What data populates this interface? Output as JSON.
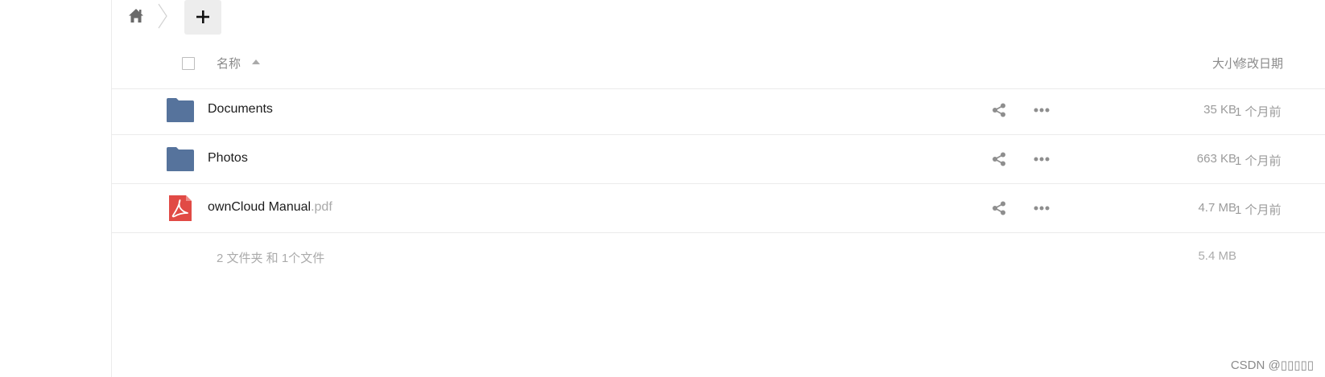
{
  "toolbar": {
    "home_icon": "home-icon",
    "new_icon": "plus-icon"
  },
  "table": {
    "headers": {
      "name": "名称",
      "size": "大小",
      "modified": "修改日期"
    },
    "sort": "name-ascending",
    "rows": [
      {
        "type": "folder",
        "icon": "folder-icon",
        "name": "Documents",
        "ext": "",
        "size": "35 KB",
        "modified": "1 个月前"
      },
      {
        "type": "folder",
        "icon": "folder-icon",
        "name": "Photos",
        "ext": "",
        "size": "663 KB",
        "modified": "1 个月前"
      },
      {
        "type": "file",
        "icon": "pdf-icon",
        "name": "ownCloud Manual",
        "ext": ".pdf",
        "size": "4.7 MB",
        "modified": "1 个月前"
      }
    ],
    "summary": {
      "text": "2 文件夹 和 1个文件",
      "size": "5.4 MB"
    }
  },
  "colors": {
    "folder": "#56739c",
    "pdf": "#e14a45",
    "muted_text": "#9b9b9b",
    "button_bg": "#ededed"
  },
  "watermark": "CSDN @▯▯▯▯▯"
}
